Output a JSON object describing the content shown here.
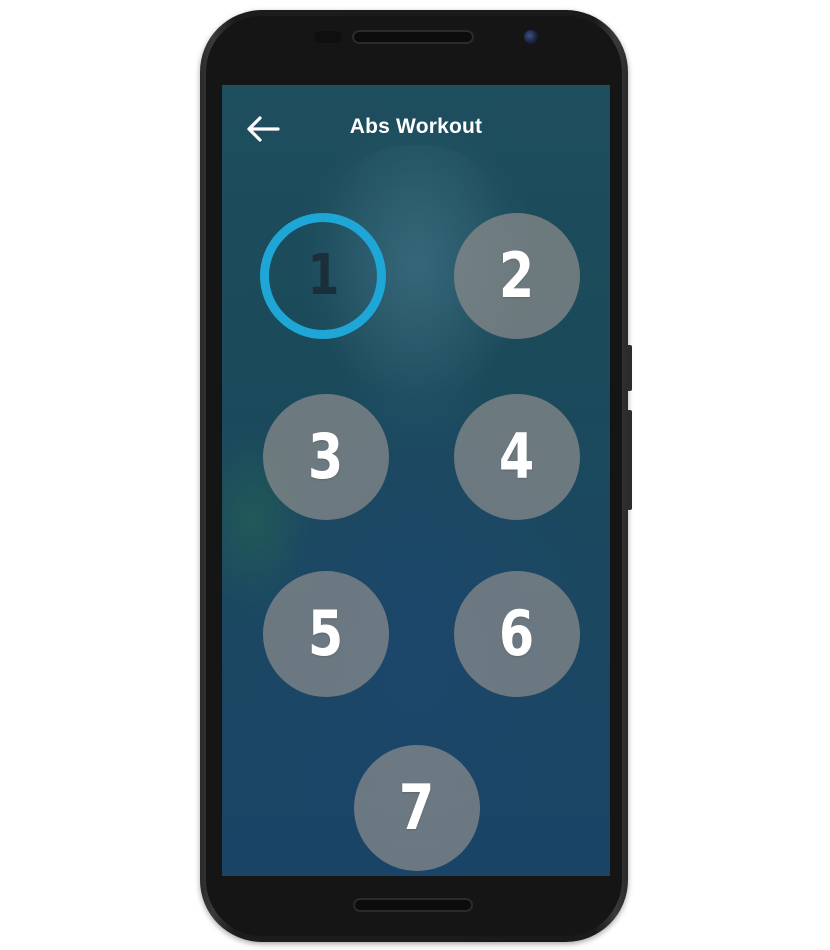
{
  "app": {
    "title": "Abs Workout"
  },
  "colors": {
    "active_ring": "#1ea6d6",
    "button_fill": "#8c8c8c",
    "screen_bg": "#1b4a5a"
  },
  "icons": {
    "back": "arrow-left-icon"
  },
  "days": [
    {
      "label": "1",
      "active": true
    },
    {
      "label": "2",
      "active": false
    },
    {
      "label": "3",
      "active": false
    },
    {
      "label": "4",
      "active": false
    },
    {
      "label": "5",
      "active": false
    },
    {
      "label": "6",
      "active": false
    },
    {
      "label": "7",
      "active": false
    }
  ]
}
